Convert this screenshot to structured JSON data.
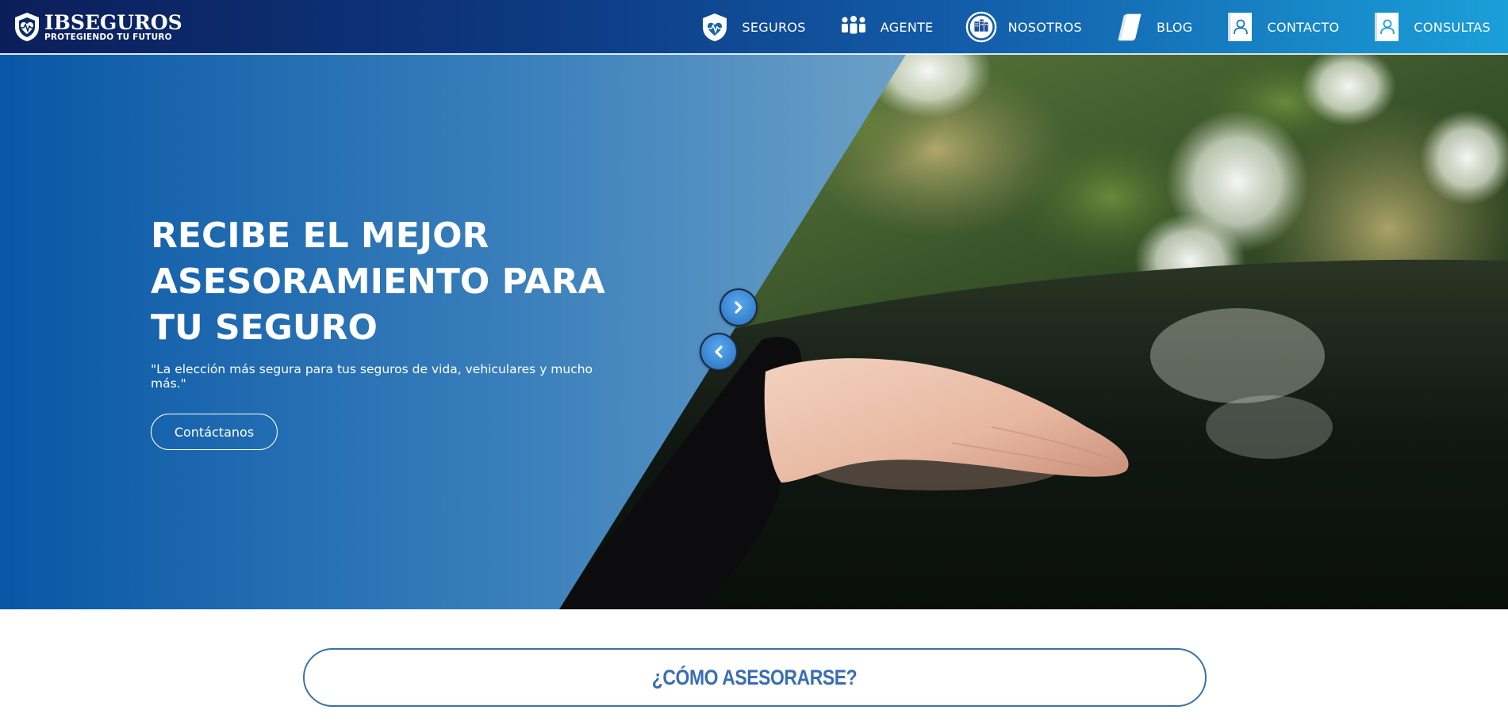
{
  "brand": {
    "name": "IBSeguros",
    "name_display": "IBSEGUROS",
    "tagline": "PROTEGIENDO TU FUTURO"
  },
  "nav": {
    "items": [
      {
        "label": "SEGUROS",
        "icon": "heart-shield-icon"
      },
      {
        "label": "AGENTE",
        "icon": "people-icon"
      },
      {
        "label": "NOSOTROS",
        "icon": "building-circle-icon"
      },
      {
        "label": "BLOG",
        "icon": "book-icon"
      },
      {
        "label": "CONTACTO",
        "icon": "contact-card-icon"
      },
      {
        "label": "CONSULTAS",
        "icon": "contact-card-icon"
      }
    ]
  },
  "hero": {
    "title": "RECIBE EL MEJOR ASESORAMIENTO PARA TU SEGURO",
    "subtitle": "\"La elección más segura para tus seguros de vida, vehiculares y mucho más.\"",
    "cta_label": "Contáctanos",
    "next_icon": "chevron-right-icon",
    "prev_icon": "chevron-left-icon"
  },
  "section": {
    "title": "¿CÓMO ASESORARSE?"
  },
  "colors": {
    "nav_start": "#0c1e5a",
    "nav_end": "#1a9fd9",
    "hero_left_start": "#0857a6",
    "hero_left_end": "#97bbd3",
    "section_title": "#3a6db3",
    "section_border": "#3a72a8"
  }
}
